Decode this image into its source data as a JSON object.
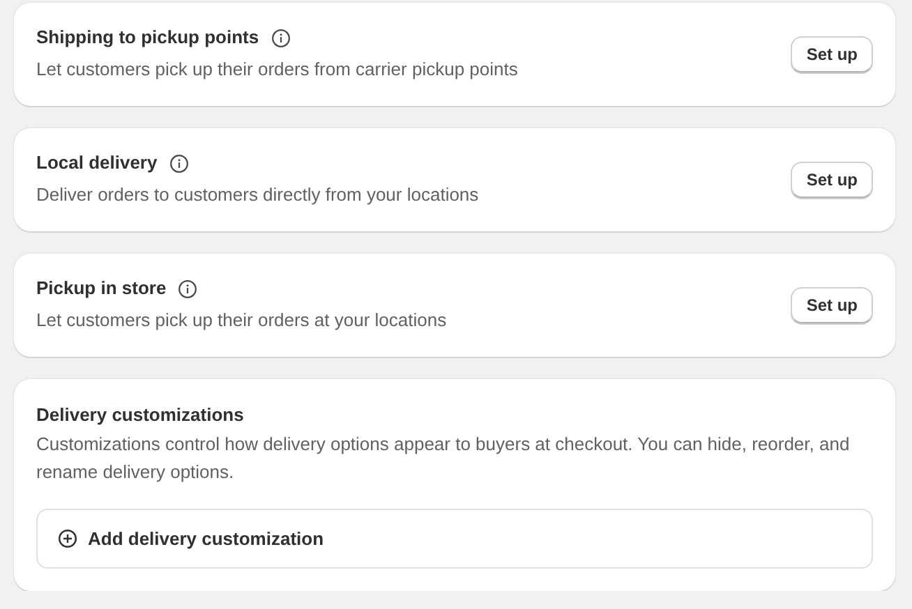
{
  "sections": [
    {
      "kind": "setup",
      "title": "Shipping to pickup points",
      "description": "Let customers pick up their orders from carrier pickup points",
      "button": "Set up"
    },
    {
      "kind": "setup",
      "title": "Local delivery",
      "description": "Deliver orders to customers directly from your locations",
      "button": "Set up"
    },
    {
      "kind": "setup",
      "title": "Pickup in store",
      "description": "Let customers pick up their orders at your locations",
      "button": "Set up"
    },
    {
      "kind": "customizations",
      "title": "Delivery customizations",
      "description": "Customizations control how delivery options appear to buyers at checkout. You can hide, reorder, and rename delivery options.",
      "action": "Add delivery customization"
    }
  ]
}
